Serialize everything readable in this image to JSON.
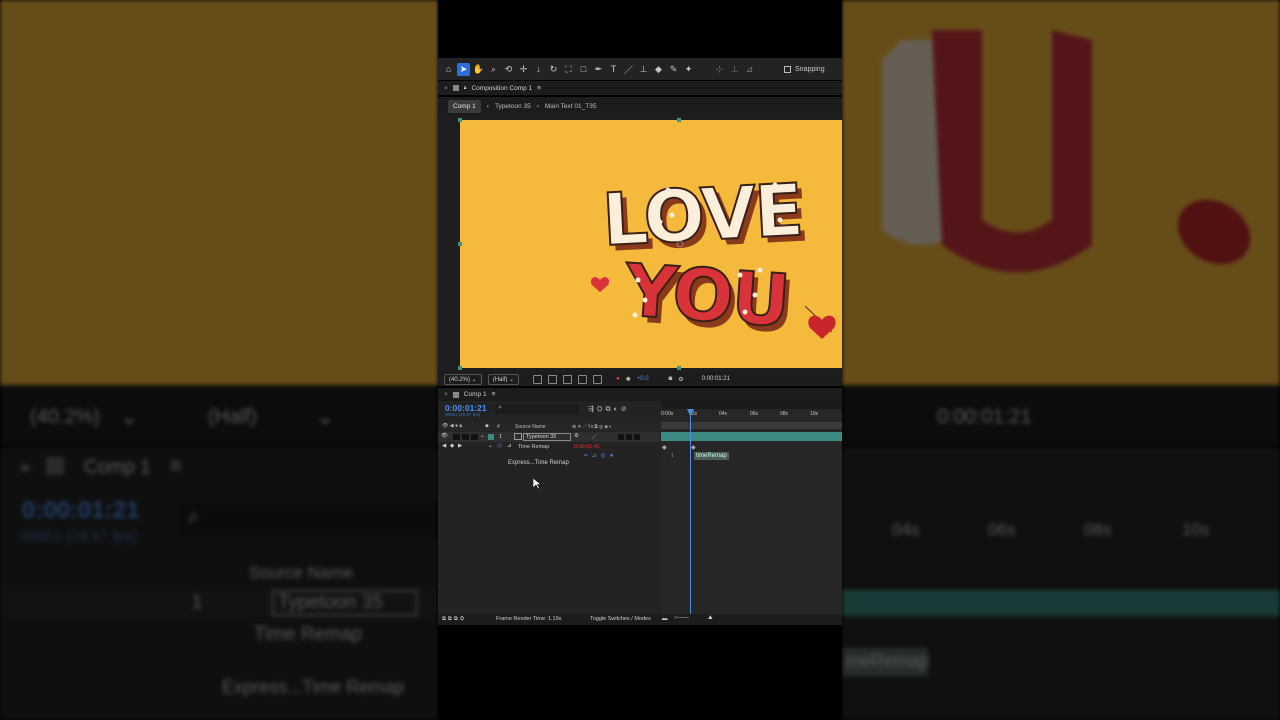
{
  "background": {
    "left_zoom": "(40.2%)",
    "left_resolution": "(Half)",
    "left_comp_title": "Comp 1",
    "left_timecode": "0:00:01:21",
    "left_fps": "00051 (29.97 fps)",
    "left_col_source": "Source Name",
    "left_layer_num": "1",
    "left_layer_name": "Typetoon 35",
    "left_time_remap": "Time Remap",
    "left_expression": "Express...Time Remap",
    "right_timecode": "0:00:01:21",
    "right_ruler": [
      "04s",
      "06s",
      "08s",
      "10s"
    ],
    "right_expr": "meRemap"
  },
  "toolbar": {
    "snapping_label": "Snapping"
  },
  "composition_panel": {
    "title": "Composition Comp 1",
    "breadcrumbs": [
      "Comp 1",
      "Typetoon 35",
      "Main Text 01_T35"
    ]
  },
  "artwork": {
    "line1": "LOVE",
    "line2": "YOU"
  },
  "viewer_bar": {
    "zoom": "(40.2%)",
    "resolution": "(Half)",
    "exposure": "+0.0",
    "timecode": "0:00:01:21"
  },
  "timeline": {
    "title": "Comp 1",
    "timecode": "0:00:01:21",
    "fps": "00051 (29.97 fps)",
    "search_placeholder": "",
    "col_num": "#",
    "col_source": "Source Name",
    "layer_num": "1",
    "layer_name": "Typetoon 35",
    "time_remap_label": "Time Remap",
    "time_remap_value": "0:00:01:41",
    "expression_label": "Express...Time Remap",
    "ruler_labels": [
      "0:00s",
      "02s",
      "04s",
      "06s",
      "08s",
      "10s"
    ],
    "expression_code_line": "1",
    "expression_code": "timeRemap",
    "frame_render_label": "Frame Render Time: 1.19s",
    "toggle_label": "Toggle Switches / Modes"
  },
  "colors": {
    "accent_blue": "#4d8ee8",
    "artwork_bg": "#f5b93c",
    "heart_red": "#d9333a",
    "track_teal": "#3c8a82"
  }
}
